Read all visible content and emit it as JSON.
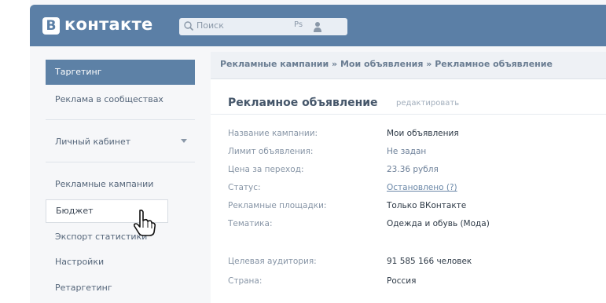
{
  "header": {
    "logo_letter": "В",
    "logo_text": "контакте",
    "search_placeholder": "Поиск",
    "search_shortcut": "Ps"
  },
  "sidebar": {
    "active_item": "Таргетинг",
    "items": [
      {
        "label": "Реклама в сообществах"
      },
      {
        "label": "Личный кабинет"
      },
      {
        "label": "Рекламные кампании"
      },
      {
        "label": "Бюджет"
      },
      {
        "label": "Экспорт статистики"
      },
      {
        "label": "Настройки"
      },
      {
        "label": "Ретаргетинг"
      }
    ]
  },
  "breadcrumb": "Рекламные кампании » Мои объявления » Рекламное объявление",
  "panel": {
    "title": "Рекламное объявление",
    "edit_link": "редактировать",
    "rows": [
      {
        "label": "Название кампании:",
        "value": "Мои объявления"
      },
      {
        "label": "Лимит объявления:",
        "value": "Не задан"
      },
      {
        "label": "Цена за переход:",
        "value": "23.36 рубля"
      },
      {
        "label": "Статус:",
        "value": "Остановлено (?)"
      },
      {
        "label": "Рекламные площадки:",
        "value": "Только ВКонтакте"
      },
      {
        "label": "Тематика:",
        "value": "Одежда и обувь (Мода)"
      },
      {
        "label": "Целевая аудитория:",
        "value": "91 585 166 человек"
      },
      {
        "label": "Страна:",
        "value": "Россия"
      }
    ]
  },
  "colors": {
    "header": "#5b7fa6",
    "active_sidebar": "#5d81a6",
    "background": "#f6f7f9"
  }
}
